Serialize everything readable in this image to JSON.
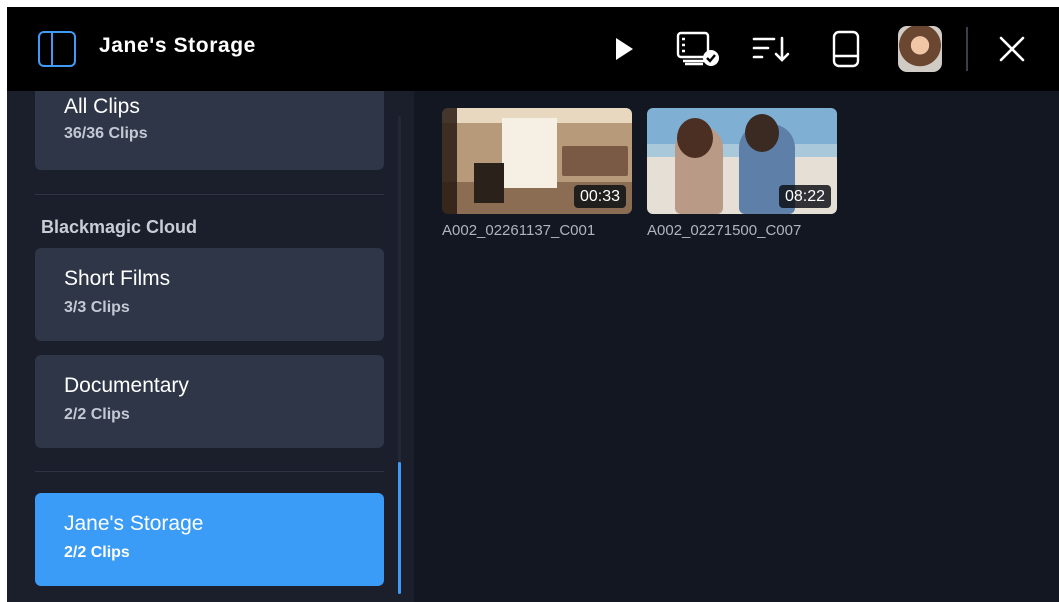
{
  "app": {
    "title": "Jane's Storage"
  },
  "toolbar": {
    "icons": [
      "sidebar-toggle-icon",
      "play-icon",
      "clip-select-icon",
      "sort-icon",
      "storage-icon",
      "avatar",
      "close-icon"
    ],
    "accent": "#3f9bf6"
  },
  "sidebar": {
    "all_clips": {
      "name": "All Clips",
      "count": "36/36 Clips"
    },
    "section_title": "Blackmagic Cloud",
    "items": [
      {
        "name": "Short Films",
        "count": "3/3 Clips"
      },
      {
        "name": "Documentary",
        "count": "2/2 Clips"
      }
    ],
    "storage": {
      "name": "Jane's Storage",
      "count": "2/2 Clips",
      "selected": true
    }
  },
  "clips": [
    {
      "name": "A002_02261137_C001",
      "duration": "00:33"
    },
    {
      "name": "A002_02271500_C007",
      "duration": "08:22"
    }
  ]
}
